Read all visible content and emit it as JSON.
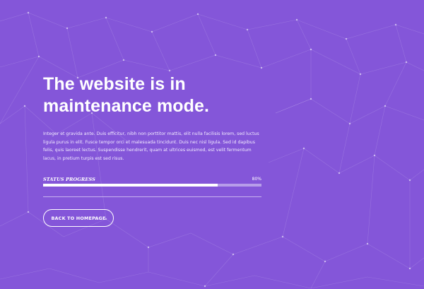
{
  "page": {
    "background_color": "#8456d9",
    "accent_color": "#ffffff"
  },
  "hero": {
    "title_line1": "The website is in",
    "title_line2": "maintenance mode.",
    "description": "Integer et gravida ante. Duis efficitur, nibh non porttitor mattis, elit nulla facilisis lorem, sed luctus ligula purus in elit. Fusce tempor orci et malesuada tincidunt. Duis nec nisl ligula. Sed id dapibus felis, quis laoreet lectus. Suspendisse hendrerit, quam at ultrices euismod, est velit fermentum lacus, in pretium turpis est sed risus."
  },
  "status": {
    "label": "STATUS PROGRESS",
    "percent_text": "80%",
    "progress_fraction": 0.8
  },
  "cta": {
    "back_label": "BACK TO HOMEPAGE"
  }
}
